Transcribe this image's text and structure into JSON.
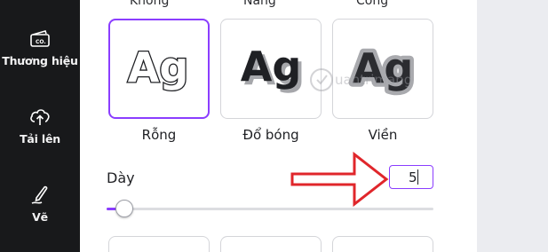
{
  "sidebar": {
    "items": [
      {
        "label": "Thương hiệu",
        "icon": "brand-icon"
      },
      {
        "label": "Tải lên",
        "icon": "upload-cloud-icon"
      },
      {
        "label": "Vẽ",
        "icon": "draw-pen-icon"
      }
    ]
  },
  "effects": {
    "top_cut_labels": [
      "Không",
      "Nâng",
      "Cong"
    ],
    "tiles": [
      {
        "sample": "Ag",
        "label": "Rỗng",
        "style": "hollow",
        "selected": true
      },
      {
        "sample": "Ag",
        "label": "Đổ bóng",
        "style": "shadow",
        "selected": false
      },
      {
        "sample": "Ag",
        "label": "Viền",
        "style": "outline",
        "selected": false
      }
    ],
    "thickness": {
      "label": "Dày",
      "value": "5",
      "slider_fraction": 0.03
    }
  },
  "watermark": {
    "text": "uantrimang"
  },
  "colors": {
    "accent": "#8b3dff",
    "sidebar_bg": "#18191b",
    "annotation_arrow": "#e0262b"
  }
}
